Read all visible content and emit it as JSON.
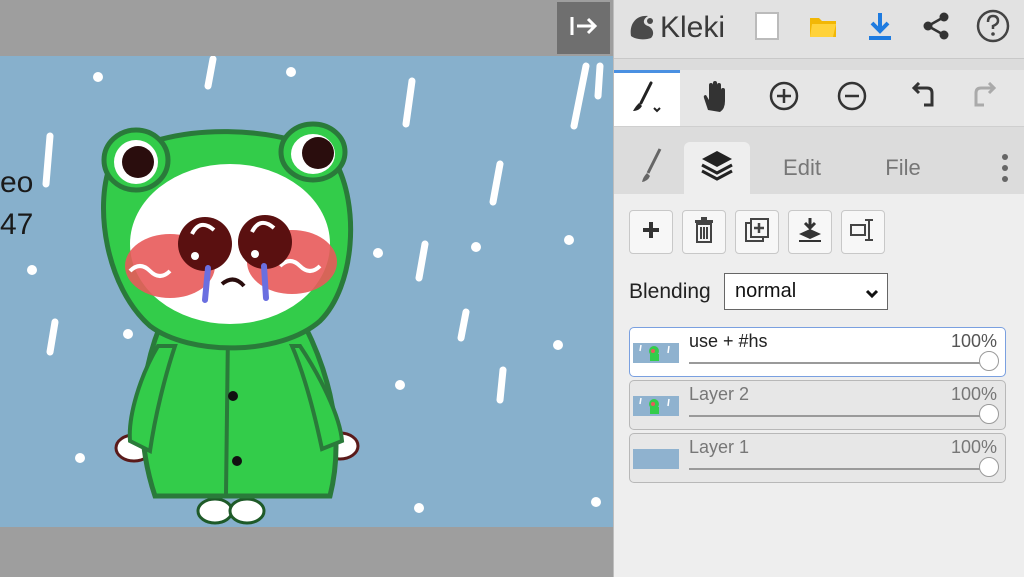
{
  "app": {
    "name": "Kleki"
  },
  "canvas": {
    "side_text_line1": "eo",
    "side_text_line2": "47",
    "background_color": "#87b0cc"
  },
  "topbar": {
    "icons": [
      "new-image-icon",
      "open-folder-icon",
      "download-icon",
      "share-icon",
      "help-icon"
    ]
  },
  "tools": {
    "items": [
      "brush-icon",
      "hand-icon",
      "zoom-in-icon",
      "zoom-out-icon",
      "undo-icon",
      "redo-icon"
    ],
    "active": "brush-icon"
  },
  "tabs": {
    "edit_label": "Edit",
    "file_label": "File",
    "active": "layers"
  },
  "layers_panel": {
    "blending_label": "Blending",
    "blending_value": "normal",
    "layers": [
      {
        "name": "use + #hs",
        "opacity": "100%",
        "active": true
      },
      {
        "name": "Layer 2",
        "opacity": "100%",
        "active": false
      },
      {
        "name": "Layer 1",
        "opacity": "100%",
        "active": false
      }
    ]
  },
  "colors": {
    "accent": "#4a90e2",
    "download": "#1e7be0",
    "folder": "#f2b705",
    "frog_green": "#33cc4a",
    "sky": "#87b0cc"
  }
}
